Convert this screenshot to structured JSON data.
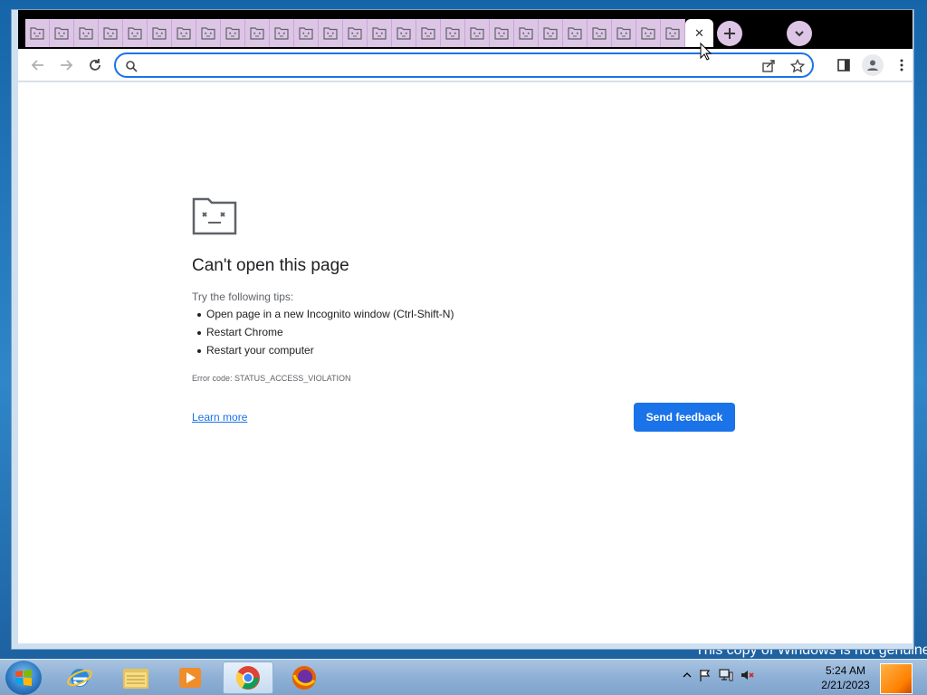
{
  "window": {
    "tab_count": 27,
    "active_tab_close": "✕",
    "newtab_label": "+",
    "omnibox": {
      "value": "",
      "placeholder": ""
    }
  },
  "error_page": {
    "title": "Can't open this page",
    "tips_label": "Try the following tips:",
    "tips": [
      "Open page in a new Incognito window (Ctrl-Shift-N)",
      "Restart Chrome",
      "Restart your computer"
    ],
    "error_code": "Error code: STATUS_ACCESS_VIOLATION",
    "learn_more": "Learn more",
    "feedback_button": "Send feedback"
  },
  "desktop": {
    "watermark": "This copy of Windows is not genuine"
  },
  "taskbar": {
    "apps": [
      "internet-explorer-icon",
      "windows-explorer-icon",
      "media-player-icon",
      "chrome-icon",
      "firefox-icon"
    ],
    "active_app": "chrome-icon",
    "clock": {
      "time": "5:24 AM",
      "date": "2/21/2023"
    }
  },
  "colors": {
    "accent": "#1a73e8",
    "tab_bg": "#ddc5e6",
    "tabstrip": "#000000"
  }
}
